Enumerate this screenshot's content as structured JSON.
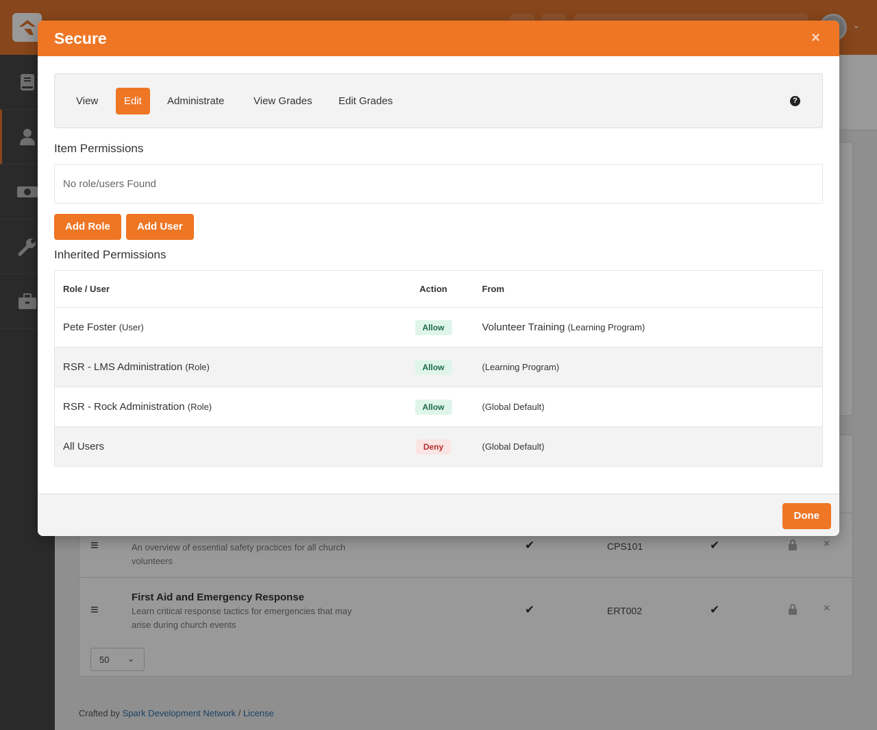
{
  "background": {
    "per_page": "50",
    "rows": [
      {
        "title": "",
        "description": "An overview of essential safety practices for all church volunteers",
        "code": "CPS101"
      },
      {
        "title": "First Aid and Emergency Response",
        "description": "Learn critical response tactics for emergencies that may arise during church events",
        "code": "ERT002"
      }
    ],
    "footer": {
      "prefix": "Crafted by",
      "link1": "Spark Development Network",
      "sep": "/",
      "link2": "License"
    }
  },
  "modal": {
    "title": "Secure",
    "close": "×",
    "tabs": [
      {
        "label": "View",
        "active": false
      },
      {
        "label": "Edit",
        "active": true
      },
      {
        "label": "Administrate",
        "active": false
      },
      {
        "label": "View Grades",
        "active": false
      },
      {
        "label": "Edit Grades",
        "active": false
      }
    ],
    "help": "?",
    "item_permissions": {
      "title": "Item Permissions",
      "empty": "No role/users Found"
    },
    "buttons": {
      "add_role": "Add Role",
      "add_user": "Add User",
      "done": "Done"
    },
    "inherited": {
      "title": "Inherited Permissions",
      "columns": [
        "Role / User",
        "Action",
        "From"
      ],
      "rows": [
        {
          "name": "Pete Foster",
          "type": "(User)",
          "action": "Allow",
          "from": "Volunteer Training",
          "from_type": "(Learning Program)"
        },
        {
          "name": "RSR - LMS Administration",
          "type": "(Role)",
          "action": "Allow",
          "from": "",
          "from_type": "(Learning Program)"
        },
        {
          "name": "RSR - Rock Administration",
          "type": "(Role)",
          "action": "Allow",
          "from": "",
          "from_type": "(Global Default)"
        },
        {
          "name": "All Users",
          "type": "",
          "action": "Deny",
          "from": "",
          "from_type": "(Global Default)"
        }
      ]
    }
  },
  "colors": {
    "accent": "#ee7625",
    "allow": "#1e6b4a",
    "deny": "#b52e2e"
  }
}
